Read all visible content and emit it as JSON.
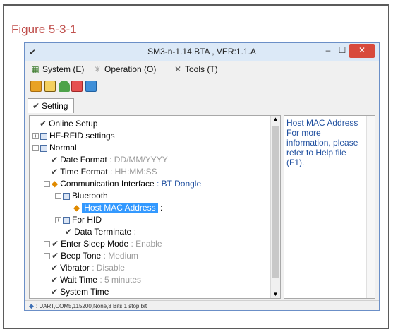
{
  "figure_caption": "Figure 5-3-1",
  "window": {
    "title": "SM3-n-1.14.BTA , VER:1.1.A",
    "min_label": "–",
    "max_label": "☐",
    "close_label": "✕"
  },
  "menu": {
    "system": "System (E)",
    "operation": "Operation (O)",
    "tools": "Tools (T)"
  },
  "tabs": [
    {
      "label": "Setting"
    }
  ],
  "tree": {
    "online_setup": "Online Setup",
    "hf_rfid": "HF-RFID settings",
    "normal": "Normal",
    "date_format": {
      "label": "Date Format",
      "value": ": DD/MM/YYYY"
    },
    "time_format": {
      "label": "Time Format",
      "value": ": HH:MM:SS"
    },
    "comm_interface": {
      "label": "Communication Interface",
      "value": ": BT Dongle"
    },
    "bluetooth": "Bluetooth",
    "host_mac": {
      "label": "Host MAC Address",
      "value": ":"
    },
    "for_hid": "For HID",
    "data_terminate": {
      "label": "Data Terminate",
      "value": ":"
    },
    "sleep_mode": {
      "label": "Enter Sleep Mode",
      "value": ": Enable"
    },
    "beep_tone": {
      "label": "Beep Tone",
      "value": ": Medium"
    },
    "vibrator": {
      "label": "Vibrator",
      "value": ": Disable"
    },
    "wait_time": {
      "label": "Wait Time",
      "value": ": 5 minutes"
    },
    "system_time": "System Time"
  },
  "help": {
    "text": "Host MAC Address For more information, please refer to Help file (F1)."
  },
  "status": {
    "text": ": UART,COM5,115200,None,8 Bits,1 stop bit"
  },
  "colors": {
    "selection": "#3399ff",
    "help_text": "#1f4f9f",
    "caption": "#c0504d",
    "close_button": "#d84a3c"
  }
}
